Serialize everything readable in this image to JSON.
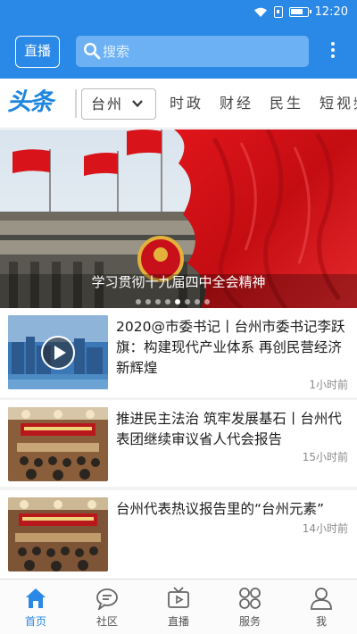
{
  "status_bar": {
    "time": "12:20",
    "icons": [
      "wifi-icon",
      "sim-icon",
      "battery-icon"
    ]
  },
  "header": {
    "live_label": "直播",
    "search_placeholder": "搜索",
    "more_icon": "more-vertical-icon"
  },
  "channel_bar": {
    "logo_text": "头条",
    "city": "台州",
    "tabs": [
      "时政",
      "财经",
      "民生",
      "短视频"
    ]
  },
  "banner": {
    "caption": "学习贯彻十九届四中全会精神",
    "slide_count": 8,
    "active_slide": 5
  },
  "news": [
    {
      "title": "2020@市委书记丨台州市委书记李跃旗：构建现代产业体系 再创民营经济新辉煌",
      "time": "1小时前",
      "has_video": true
    },
    {
      "title": "推进民主法治 筑牢发展基石丨台州代表团继续审议省人代会报告",
      "time": "15小时前",
      "has_video": false
    },
    {
      "title": "台州代表热议报告里的“台州元素”",
      "time": "14小时前",
      "has_video": false
    }
  ],
  "bottom_nav": [
    {
      "label": "首页",
      "icon": "home-icon",
      "active": true
    },
    {
      "label": "社区",
      "icon": "chat-bubble-icon",
      "active": false
    },
    {
      "label": "直播",
      "icon": "tv-icon",
      "active": false
    },
    {
      "label": "服务",
      "icon": "grid-icon",
      "active": false
    },
    {
      "label": "我",
      "icon": "user-icon",
      "active": false
    }
  ],
  "colors": {
    "primary": "#2a88e6",
    "search_bg": "#6bb1f3",
    "flag_red": "#d8141a"
  }
}
